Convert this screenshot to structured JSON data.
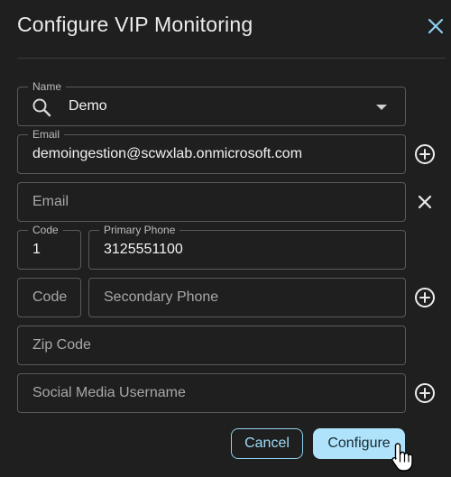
{
  "dialog": {
    "title": "Configure VIP Monitoring",
    "close_icon": "close-icon"
  },
  "form": {
    "name": {
      "label": "Name",
      "value": "Demo",
      "icons": [
        "search-icon",
        "dropdown-arrow-icon"
      ]
    },
    "email_1": {
      "label": "Email",
      "value": "demoingestion@scwxlab.onmicrosoft.com",
      "action_icon": "add-circle-icon"
    },
    "email_2": {
      "placeholder": "Email",
      "action_icon": "close-icon"
    },
    "code_1": {
      "label": "Code",
      "value": "1"
    },
    "primary_phone": {
      "label": "Primary Phone",
      "value": "3125551100"
    },
    "code_2": {
      "placeholder": "Code"
    },
    "secondary_phone": {
      "placeholder": "Secondary Phone",
      "action_icon": "add-circle-icon"
    },
    "zip_code": {
      "placeholder": "Zip Code"
    },
    "social_media": {
      "placeholder": "Social Media Username",
      "action_icon": "add-circle-icon"
    }
  },
  "actions": {
    "cancel_label": "Cancel",
    "configure_label": "Configure"
  },
  "colors": {
    "background": "#1f1f1f",
    "accent": "#aee3fb",
    "border": "#5a5a5a"
  }
}
